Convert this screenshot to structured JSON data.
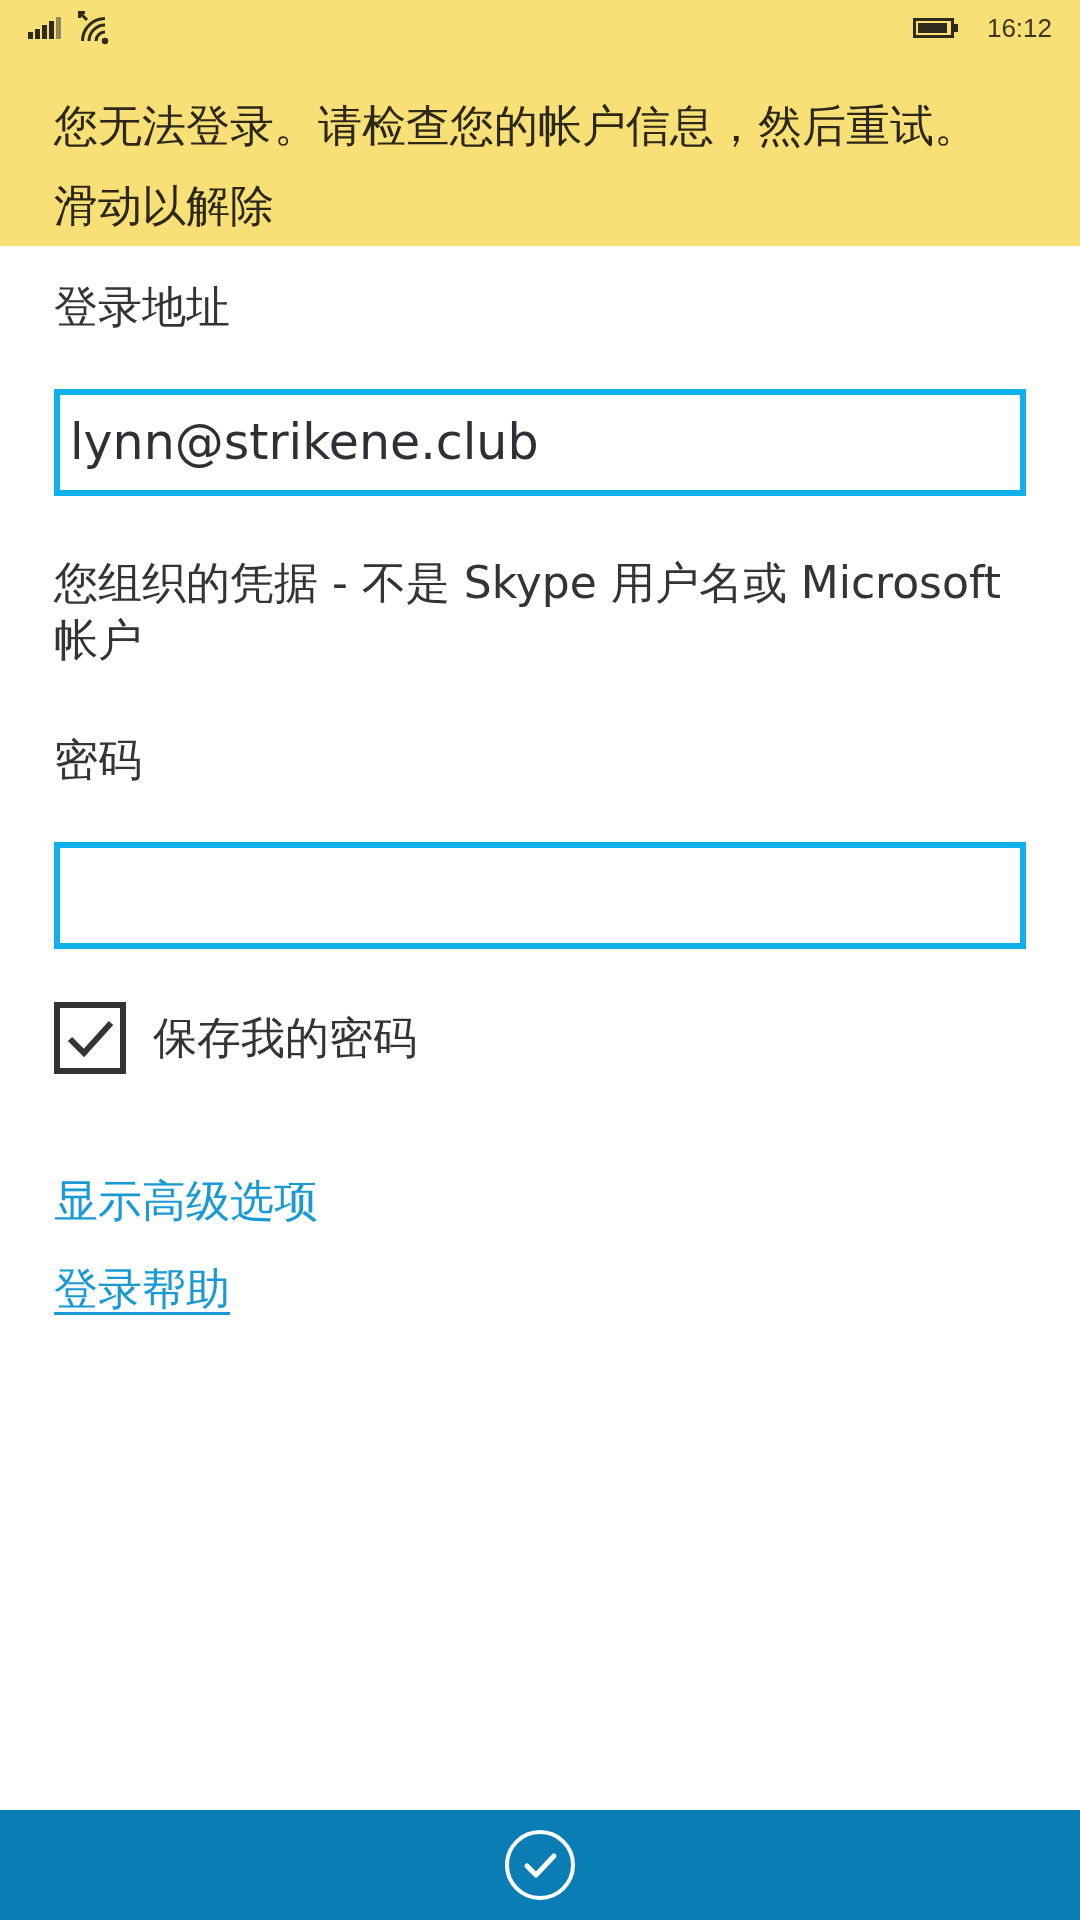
{
  "status_bar": {
    "time": "16:12"
  },
  "banner": {
    "message": "您无法登录。请检查您的帐户信息，然后重试。",
    "dismiss_hint": "滑动以解除"
  },
  "fields": [
    {
      "label": "登录地址",
      "value": "lynn@strikene.club",
      "hint": "您组织的凭据 - 不是 Skype 用户名或 Microsoft 帐户"
    },
    {
      "label": "密码"
    }
  ],
  "save_password": {
    "label": "保存我的密码",
    "checked": true
  },
  "links": [
    {
      "label": "显示高级选项",
      "underlined": false
    },
    {
      "label": "登录帮助",
      "underlined": true
    }
  ]
}
